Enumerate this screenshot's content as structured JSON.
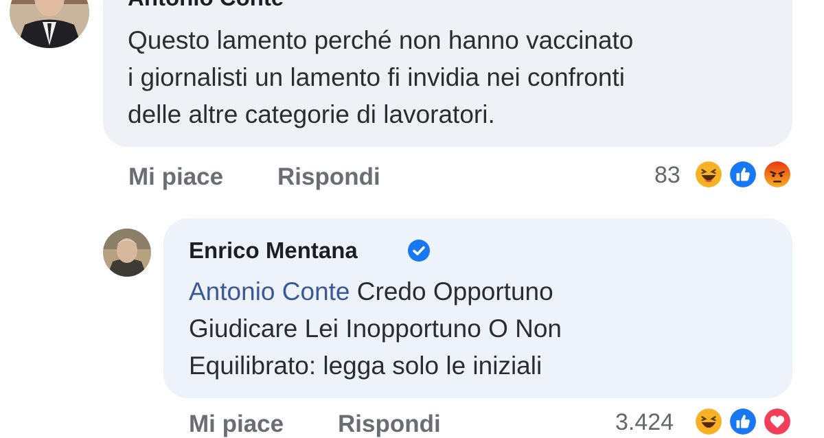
{
  "comments": [
    {
      "author": "Antonio Conte",
      "text_lines": [
        "Questo lamento perché non hanno vaccinato",
        "i giornalisti un lamento fi invidia nei confronti",
        "delle altre categorie di lavoratori."
      ],
      "actions": {
        "like_label": "Mi piace",
        "reply_label": "Rispondi"
      },
      "reaction_count": "83",
      "reactions": [
        "haha-icon",
        "like-icon",
        "angry-icon"
      ]
    },
    {
      "author": "Enrico Mentana",
      "verified": true,
      "mention": "Antonio Conte",
      "text_lines": [
        " Credo Opportuno",
        "Giudicare Lei Inopportuno O Non",
        "Equilibrato: legga solo le iniziali"
      ],
      "actions": {
        "like_label": "Mi piace",
        "reply_label": "Rispondi"
      },
      "reaction_count": "3.424",
      "reactions": [
        "haha-icon",
        "like-icon",
        "love-icon"
      ]
    }
  ],
  "colors": {
    "bubble": "#eff1f6",
    "mention": "#385898",
    "verified": "#1877f2",
    "like": "#1877f2",
    "haha": "#f7b125",
    "angry": "#e9710f",
    "love": "#f33e58"
  }
}
